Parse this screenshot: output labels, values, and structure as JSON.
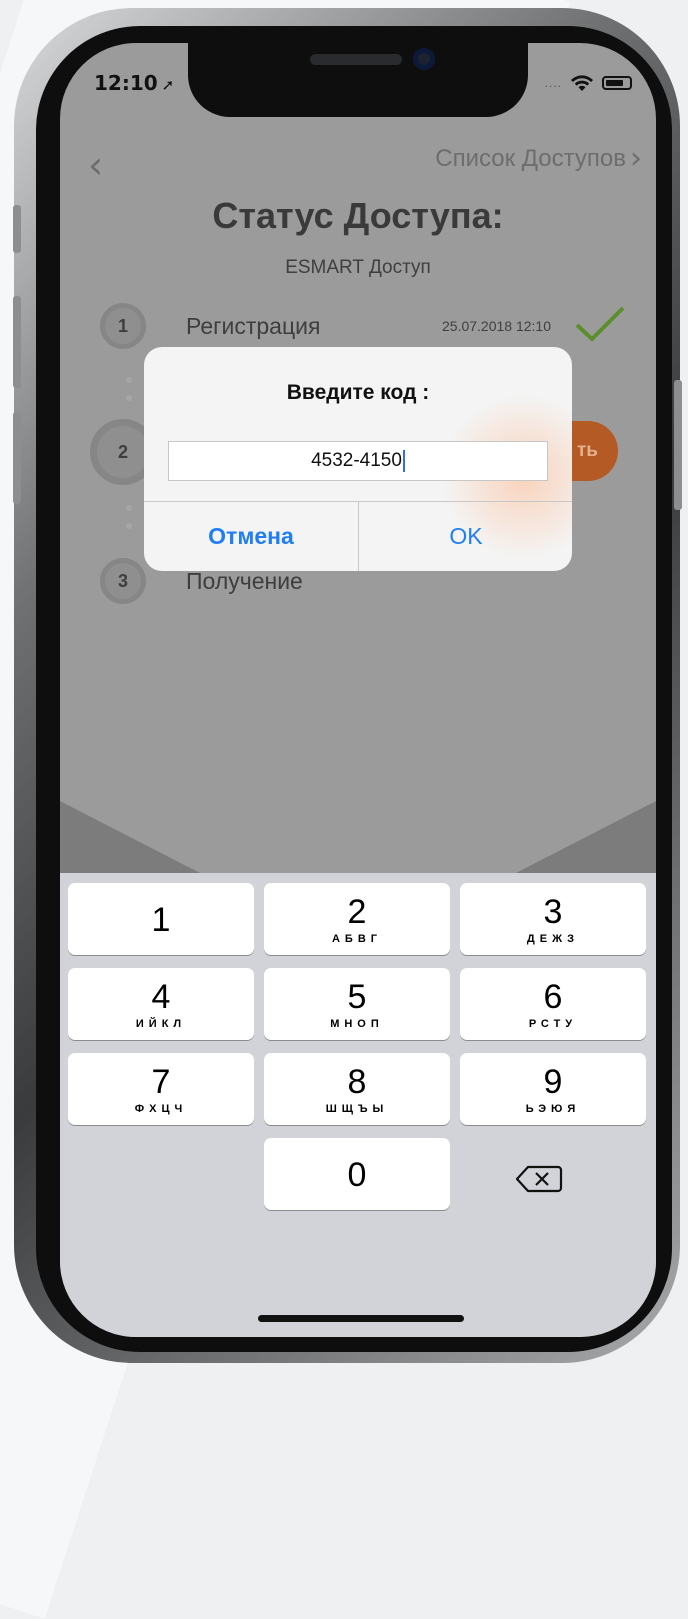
{
  "status_bar": {
    "time": "12:10",
    "location_arrow": "➚",
    "signal_dots": "....",
    "wifi_icon": "wifi-icon",
    "battery_icon": "battery-icon"
  },
  "nav": {
    "back_glyph": "‹",
    "right_label": "Список Доступов",
    "right_chevron": "›"
  },
  "header": {
    "title": "Статус Доступа:",
    "subtitle": "ESMART Доступ"
  },
  "steps": [
    {
      "number": "1",
      "label": "Регистрация",
      "date": "25.07.2018 12:10",
      "done": true
    },
    {
      "number": "2",
      "label": "",
      "action_partial": "ть"
    },
    {
      "number": "3",
      "label": "Получение"
    }
  ],
  "dialog": {
    "title": "Введите код :",
    "input_value": "4532-4150",
    "cancel_label": "Отмена",
    "ok_label": "OK"
  },
  "keypad": {
    "keys": [
      {
        "num": "1",
        "letters": ""
      },
      {
        "num": "2",
        "letters": "АБВГ"
      },
      {
        "num": "3",
        "letters": "ДЕЖЗ"
      },
      {
        "num": "4",
        "letters": "ИЙКЛ"
      },
      {
        "num": "5",
        "letters": "МНОП"
      },
      {
        "num": "6",
        "letters": "РСТУ"
      },
      {
        "num": "7",
        "letters": "ФХЦЧ"
      },
      {
        "num": "8",
        "letters": "ШЩЪЫ"
      },
      {
        "num": "9",
        "letters": "ЬЭЮЯ"
      },
      {
        "num": "0",
        "letters": ""
      }
    ],
    "backspace_icon": "backspace-icon"
  },
  "colors": {
    "accent_blue": "#1f7ef5",
    "check_green": "#5b8f2b",
    "action_orange": "#b35a25",
    "overlay_gray": "#9b9b9b"
  }
}
